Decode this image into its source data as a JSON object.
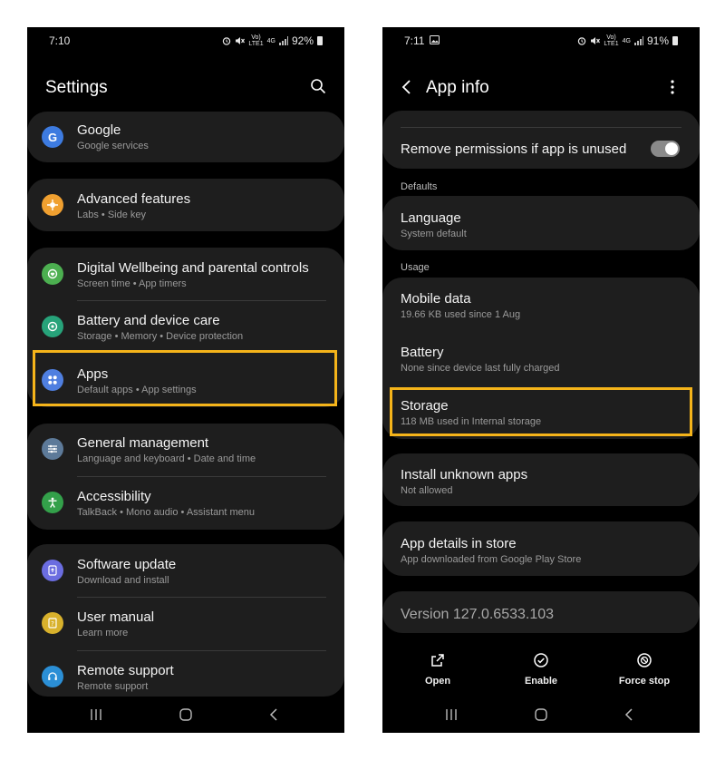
{
  "left": {
    "status": {
      "time": "7:10",
      "battery": "92%",
      "net_top": "Vo)",
      "net_bottom": "LTE1",
      "net_type": "4G"
    },
    "title": "Settings",
    "items": [
      {
        "title": "Google",
        "sub": "Google services"
      },
      {
        "title": "Advanced features",
        "sub": "Labs  •  Side key"
      },
      {
        "title": "Digital Wellbeing and parental controls",
        "sub": "Screen time  •  App timers"
      },
      {
        "title": "Battery and device care",
        "sub": "Storage  •  Memory  •  Device protection"
      },
      {
        "title": "Apps",
        "sub": "Default apps  •  App settings"
      },
      {
        "title": "General management",
        "sub": "Language and keyboard  •  Date and time"
      },
      {
        "title": "Accessibility",
        "sub": "TalkBack  •  Mono audio  •  Assistant menu"
      },
      {
        "title": "Software update",
        "sub": "Download and install"
      },
      {
        "title": "User manual",
        "sub": "Learn more"
      },
      {
        "title": "Remote support",
        "sub": "Remote support"
      }
    ],
    "icon_colors": {
      "google": "#3d7be0",
      "advanced": "#f0a030",
      "wellbeing": "#4caf50",
      "battery": "#27a37a",
      "apps": "#4f7fe0",
      "general": "#5d7a99",
      "accessibility": "#33a04a",
      "software": "#6b6de0",
      "manual": "#d8b12c",
      "remote": "#2b8fd6"
    }
  },
  "right": {
    "status": {
      "time": "7:11",
      "battery": "91%",
      "net_top": "Vo)",
      "net_bottom": "LTE1",
      "net_type": "4G"
    },
    "title": "App info",
    "remove_permissions": "Remove permissions if app is unused",
    "remove_permissions_on": true,
    "section_defaults": "Defaults",
    "language": {
      "title": "Language",
      "sub": "System default"
    },
    "section_usage": "Usage",
    "mobile_data": {
      "title": "Mobile data",
      "sub": "19.66 KB used since 1 Aug"
    },
    "battery": {
      "title": "Battery",
      "sub": "None since device last fully charged"
    },
    "storage": {
      "title": "Storage",
      "sub": "118 MB used in Internal storage"
    },
    "install_unknown": {
      "title": "Install unknown apps",
      "sub": "Not allowed"
    },
    "app_details": {
      "title": "App details in store",
      "sub": "App downloaded from Google Play Store"
    },
    "version": "Version 127.0.6533.103",
    "actions": {
      "open": "Open",
      "enable": "Enable",
      "force_stop": "Force stop"
    }
  },
  "highlight_color": "#f5b41a"
}
